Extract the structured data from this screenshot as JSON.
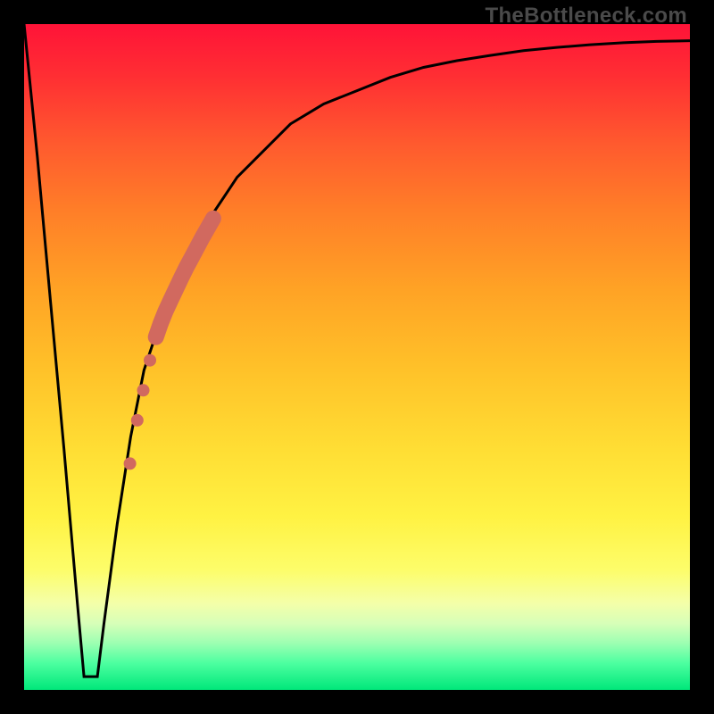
{
  "attribution": "TheBottleneck.com",
  "colors": {
    "frame": "#000000",
    "curve": "#000000",
    "marker": "#d1695f"
  },
  "chart_data": {
    "type": "line",
    "title": "",
    "xlabel": "",
    "ylabel": "",
    "xlim": [
      0,
      100
    ],
    "ylim": [
      0,
      100
    ],
    "grid": false,
    "legend": false,
    "series": [
      {
        "name": "bottleneck-curve",
        "x": [
          0,
          2,
          4,
          6,
          8,
          9,
          10,
          11,
          12,
          14,
          16,
          18,
          20,
          24,
          28,
          32,
          36,
          40,
          45,
          50,
          55,
          60,
          65,
          70,
          75,
          80,
          85,
          90,
          95,
          100
        ],
        "y": [
          100,
          80,
          58,
          36,
          13,
          2,
          2,
          2,
          10,
          25,
          38,
          48,
          54,
          64,
          71,
          77,
          81,
          85,
          88,
          90,
          92,
          93.5,
          94.5,
          95.3,
          96,
          96.5,
          96.9,
          97.2,
          97.4,
          97.5
        ],
        "stroke": "#000000",
        "markers": false
      },
      {
        "name": "highlight-band",
        "x": [
          19.8,
          20.5,
          21.2,
          22.0,
          22.8,
          23.6,
          24.4,
          25.2,
          26.0,
          26.8,
          27.6,
          28.4
        ],
        "y": [
          53.0,
          55.0,
          56.8,
          58.5,
          60.2,
          61.9,
          63.5,
          65.0,
          66.5,
          68.0,
          69.4,
          70.8
        ],
        "stroke": "#d1695f",
        "stroke_width": 14,
        "markers": false
      },
      {
        "name": "highlight-dots",
        "x": [
          17.0,
          17.9,
          18.9
        ],
        "y": [
          40.5,
          45.0,
          49.5
        ],
        "marker_color": "#d1695f",
        "marker_radius": 7,
        "markers": true
      },
      {
        "name": "highlight-dot-lower",
        "x": [
          15.9
        ],
        "y": [
          34.0
        ],
        "marker_color": "#d1695f",
        "marker_radius": 7,
        "markers": true
      }
    ],
    "annotations": []
  }
}
